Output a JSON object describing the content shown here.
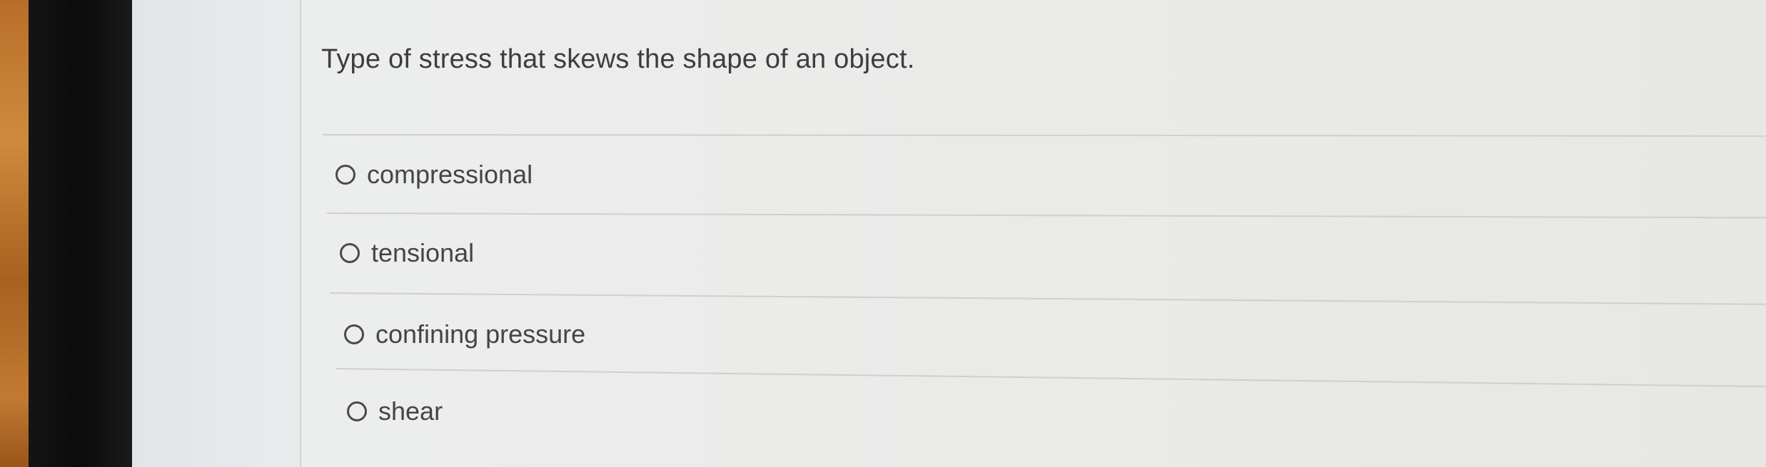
{
  "question": {
    "text": "Type of stress that skews the shape of an object."
  },
  "options": [
    {
      "label": "compressional",
      "selected": false
    },
    {
      "label": "tensional",
      "selected": false
    },
    {
      "label": "confining pressure",
      "selected": false
    },
    {
      "label": "shear",
      "selected": false
    }
  ]
}
